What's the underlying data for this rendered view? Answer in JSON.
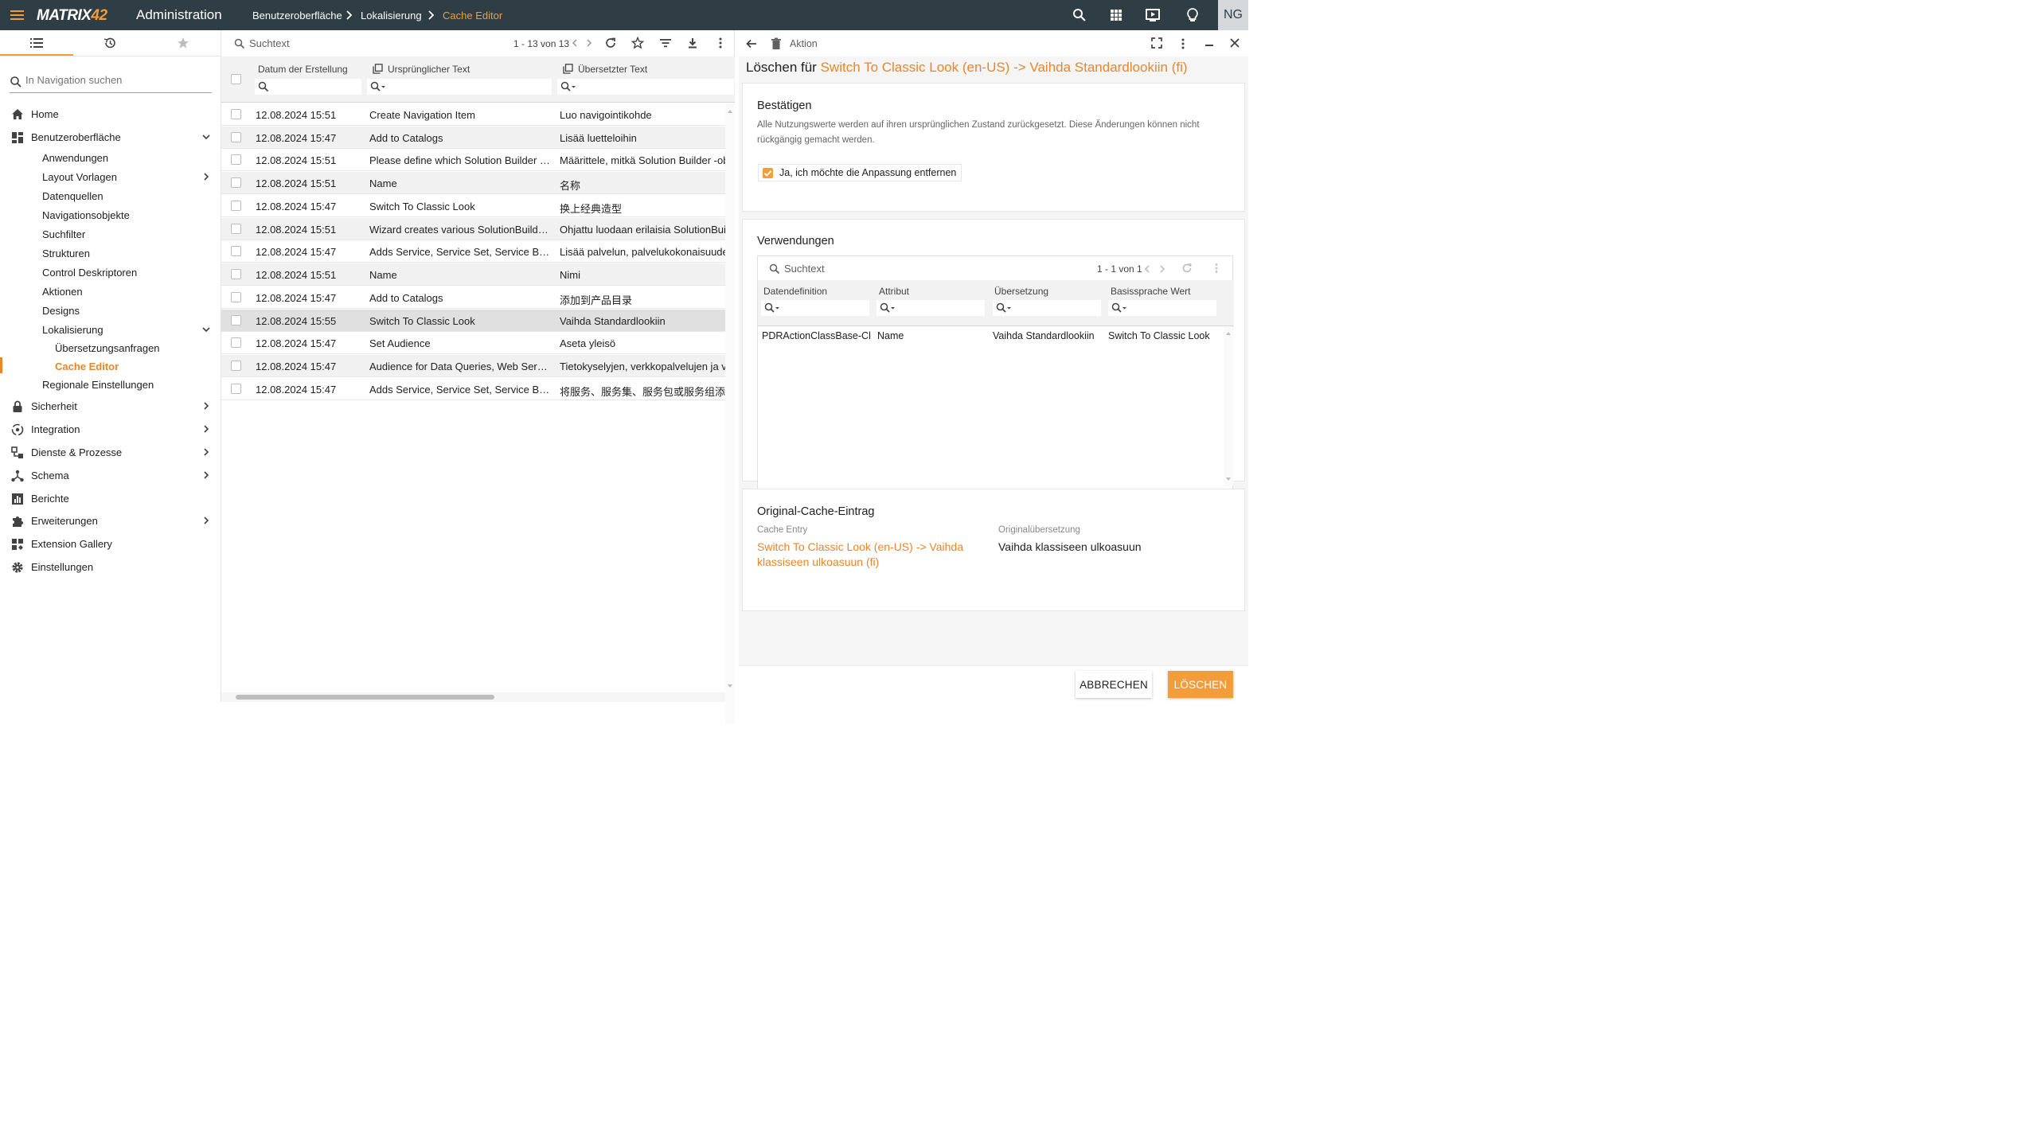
{
  "topbar": {
    "logo_main": "MATRIX",
    "logo_accent": "42",
    "app_title": "Administration",
    "breadcrumb": [
      "Benutzeroberfläche",
      "Lokalisierung",
      "Cache Editor"
    ],
    "avatar": "NG",
    "icons": [
      "menu-icon",
      "search-icon",
      "apps-grid-icon",
      "presentation-icon",
      "lightbulb-icon"
    ],
    "accent_color": "#f39c3a",
    "bar_color": "#2f3d45"
  },
  "sidebar": {
    "tabs": [
      "list-icon",
      "history-icon",
      "star-icon"
    ],
    "search_placeholder": "In Navigation suchen",
    "items": [
      {
        "label": "Home",
        "icon": "home-icon"
      },
      {
        "label": "Benutzeroberfläche",
        "icon": "dashboard-icon",
        "expanded": true
      },
      {
        "label": "Anwendungen"
      },
      {
        "label": "Layout Vorlagen",
        "has_children": true
      },
      {
        "label": "Datenquellen"
      },
      {
        "label": "Navigationsobjekte"
      },
      {
        "label": "Suchfilter"
      },
      {
        "label": "Strukturen"
      },
      {
        "label": "Control Deskriptoren"
      },
      {
        "label": "Aktionen"
      },
      {
        "label": "Designs"
      },
      {
        "label": "Lokalisierung",
        "expanded": true
      },
      {
        "label": "Übersetzungsanfragen"
      },
      {
        "label": "Cache Editor",
        "active": true
      },
      {
        "label": "Regionale Einstellungen"
      },
      {
        "label": "Sicherheit",
        "icon": "lock-icon",
        "has_children": true
      },
      {
        "label": "Integration",
        "icon": "integration-icon",
        "has_children": true
      },
      {
        "label": "Dienste & Prozesse",
        "icon": "services-icon",
        "has_children": true
      },
      {
        "label": "Schema",
        "icon": "schema-icon",
        "has_children": true
      },
      {
        "label": "Berichte",
        "icon": "reports-icon"
      },
      {
        "label": "Erweiterungen",
        "icon": "puzzle-icon",
        "has_children": true
      },
      {
        "label": "Extension Gallery",
        "icon": "gallery-icon"
      },
      {
        "label": "Einstellungen",
        "icon": "gear-icon"
      }
    ]
  },
  "list": {
    "search_placeholder": "Suchtext",
    "count": "1 - 13 von 13",
    "columns": [
      "Datum der Erstellung",
      "Ursprünglicher Text",
      "Übersetzter Text"
    ],
    "rows": [
      {
        "date": "12.08.2024 15:51",
        "orig": "Create Navigation Item",
        "trans": "Luo navigointikohde"
      },
      {
        "date": "12.08.2024 15:47",
        "orig": "Add to Catalogs",
        "trans": "Lisää luetteloihin"
      },
      {
        "date": "12.08.2024 15:51",
        "orig": "Please define which Solution Builder obj…",
        "trans": "Määrittele, mitkä Solution Builder -objekt"
      },
      {
        "date": "12.08.2024 15:51",
        "orig": "Name",
        "trans": "名称"
      },
      {
        "date": "12.08.2024 15:47",
        "orig": "Switch To Classic Look",
        "trans": "换上经典造型"
      },
      {
        "date": "12.08.2024 15:51",
        "orig": "Wizard creates various SolutionBuilder …",
        "trans": "Ohjattu luodaan erilaisia SolutionBuilder"
      },
      {
        "date": "12.08.2024 15:47",
        "orig": "Adds Service, Service Set, Service Bundl…",
        "trans": "Lisää palvelun, palvelukokonaisuuden"
      },
      {
        "date": "12.08.2024 15:51",
        "orig": "Name",
        "trans": "Nimi"
      },
      {
        "date": "12.08.2024 15:47",
        "orig": "Add to Catalogs",
        "trans": "添加到产品目录"
      },
      {
        "date": "12.08.2024 15:55",
        "orig": "Switch To Classic Look",
        "trans": "Vaihda Standardlookiin",
        "selected": true
      },
      {
        "date": "12.08.2024 15:47",
        "orig": "Set Audience",
        "trans": "Aseta yleisö"
      },
      {
        "date": "12.08.2024 15:47",
        "orig": "Audience for Data Queries, Web Service…",
        "trans": "Tietokyselyjen, verkkopalvelujen ja verk"
      },
      {
        "date": "12.08.2024 15:47",
        "orig": "Adds Service, Service Set, Service Bundl…",
        "trans": "将服务、服务集、服务包或服务组添加"
      }
    ]
  },
  "detail": {
    "toolbar_label": "Aktion",
    "title_prefix": "Löschen für",
    "title_highlight": "Switch To Classic Look (en-US) -> Vaihda Standardlookiin (fi)",
    "confirm": {
      "heading": "Bestätigen",
      "text": "Alle Nutzungswerte werden auf ihren ursprünglichen Zustand zurückgesetzt. Diese Änderungen können nicht rückgängig gemacht werden.",
      "checkbox_label": "Ja, ich möchte die Anpassung entfernen",
      "checked": true
    },
    "usages": {
      "heading": "Verwendungen",
      "search_placeholder": "Suchtext",
      "count": "1 - 1 von 1",
      "columns": [
        "Datendefinition",
        "Attribut",
        "Übersetzung",
        "Basissprache Wert"
      ],
      "rows": [
        {
          "def": "PDRActionClassBase-Cl",
          "attr": "Name",
          "trans": "Vaihda Standardlookiin",
          "base": "Switch To Classic Look"
        }
      ]
    },
    "original": {
      "heading": "Original-Cache-Eintrag",
      "entry_label": "Cache Entry",
      "entry_value": "Switch To Classic Look (en-US) -> Vaihda klassiseen ulkoasuun (fi)",
      "translation_label": "Originalübersetzung",
      "translation_value": "Vaihda klassiseen ulkoasuun"
    },
    "buttons": {
      "cancel": "ABBRECHEN",
      "delete": "LÖSCHEN"
    }
  }
}
